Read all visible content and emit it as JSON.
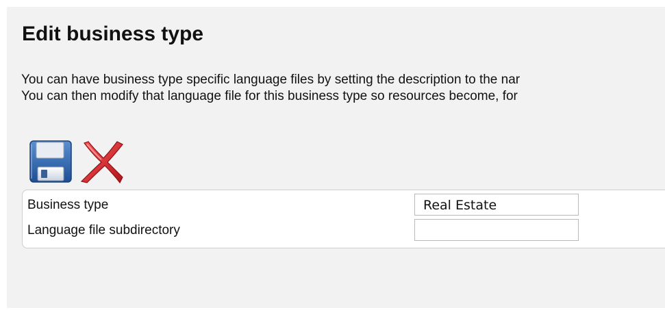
{
  "page": {
    "title": "Edit business type",
    "description_lines": [
      "You can have business type specific language files by setting the description to the nar",
      "You can then modify that language file for this business type so resources become, for"
    ]
  },
  "toolbar": {
    "save_icon": "floppy-disk-save-icon",
    "cancel_icon": "red-x-cancel-icon",
    "colors": {
      "save_body": "#2a5fa6",
      "cancel_red": "#d8262b"
    }
  },
  "form": {
    "fields": [
      {
        "label": "Business type",
        "value": "Real Estate",
        "placeholder": ""
      },
      {
        "label": "Language file subdirectory",
        "value": "",
        "placeholder": ""
      }
    ]
  }
}
